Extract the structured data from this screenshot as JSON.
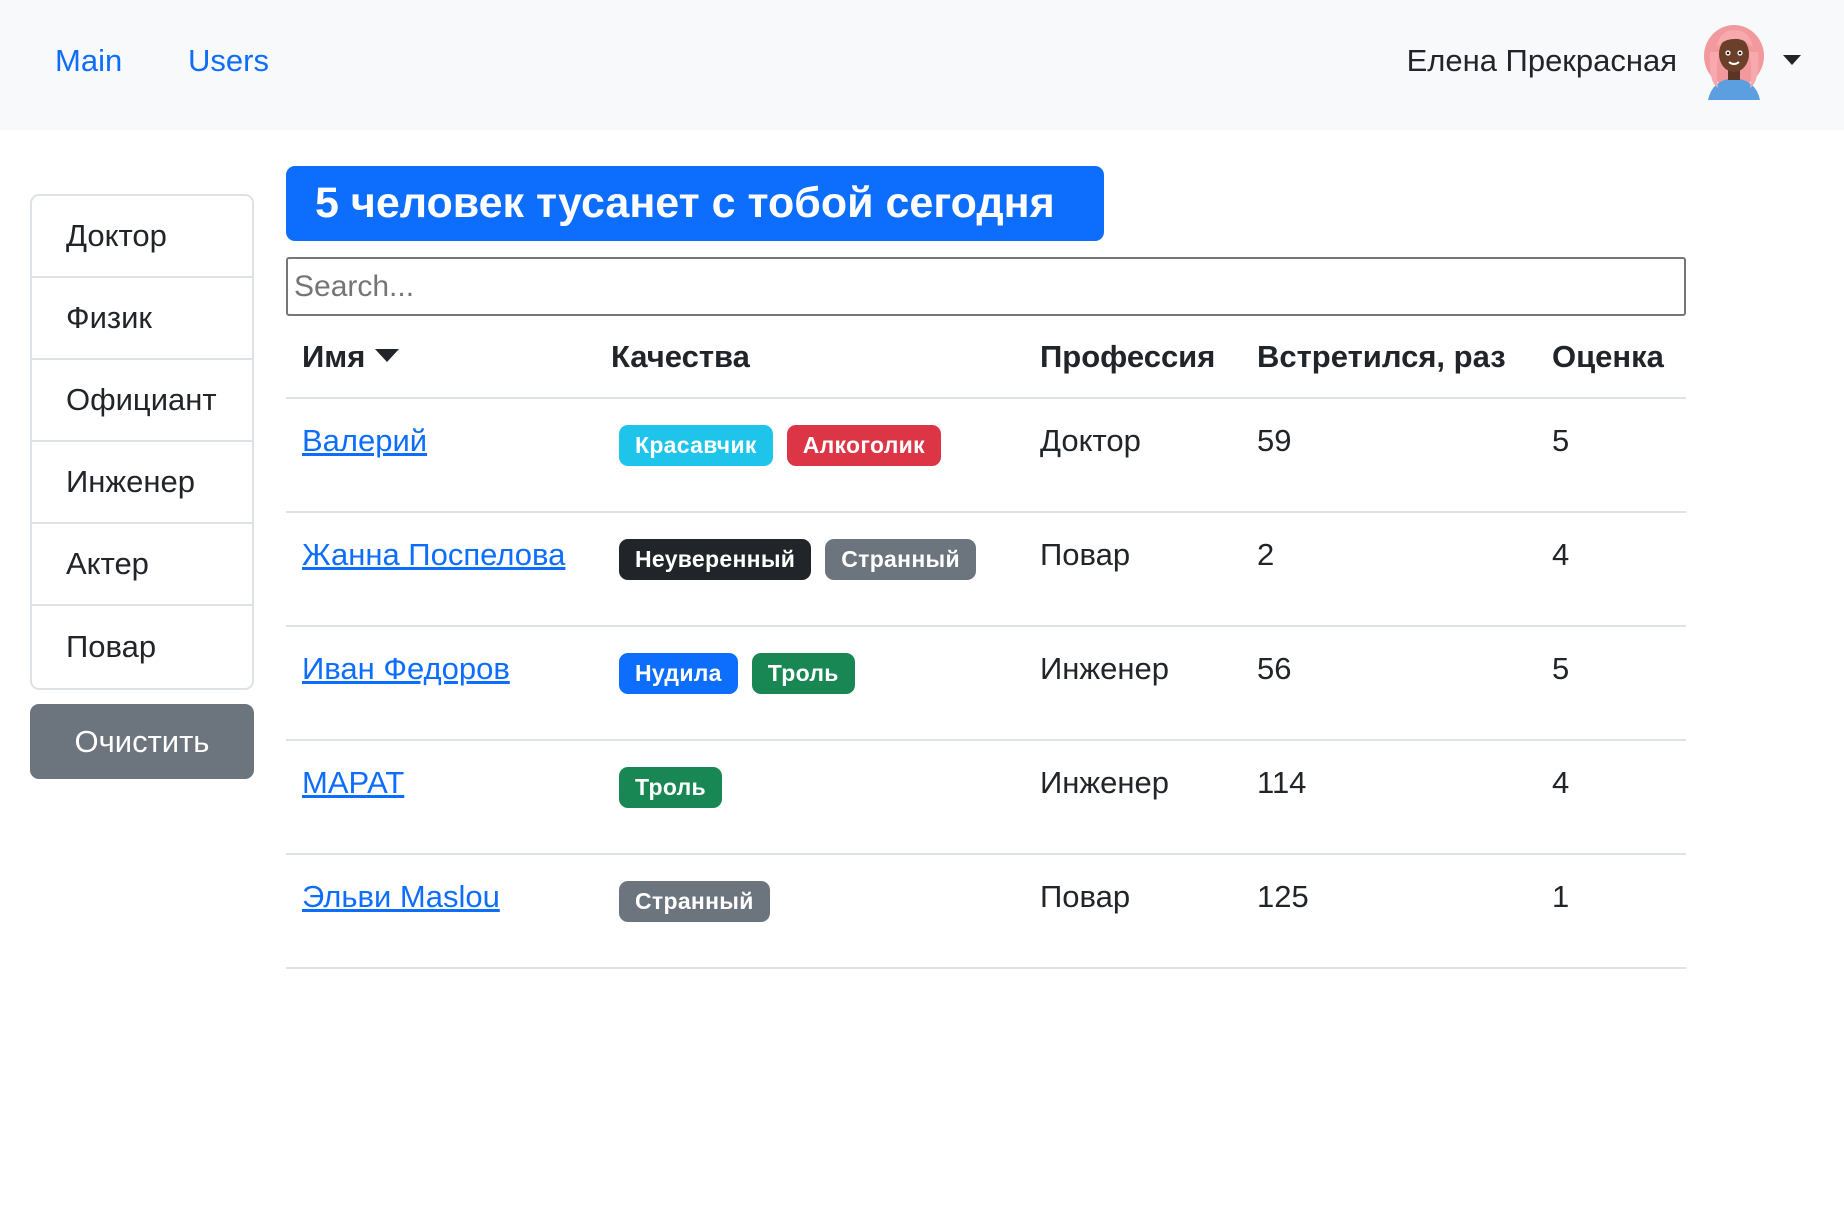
{
  "navbar": {
    "links": [
      {
        "label": "Main"
      },
      {
        "label": "Users"
      }
    ],
    "user_name": "Елена Прекрасная"
  },
  "sidebar": {
    "items": [
      {
        "label": "Доктор"
      },
      {
        "label": "Физик"
      },
      {
        "label": "Официант"
      },
      {
        "label": "Инженер"
      },
      {
        "label": "Актер"
      },
      {
        "label": "Повар"
      }
    ],
    "clear_label": "Очистить"
  },
  "banner": {
    "text": "5 человек тусанет с тобой сегодня"
  },
  "search": {
    "placeholder": "Search..."
  },
  "table": {
    "headers": {
      "name": "Имя",
      "qualities": "Качества",
      "profession": "Профессия",
      "met": "Встретился, раз",
      "rating": "Оценка"
    },
    "rows": [
      {
        "name": "Валерий",
        "qualities": [
          {
            "label": "Красавчик",
            "color": "#1ec4ea"
          },
          {
            "label": "Алкоголик",
            "color": "#dc3545"
          }
        ],
        "profession": "Доктор",
        "met": "59",
        "rating": "5"
      },
      {
        "name": "Жанна Поспелова",
        "qualities": [
          {
            "label": "Неуверенный",
            "color": "#212529"
          },
          {
            "label": "Странный",
            "color": "#6c757d"
          }
        ],
        "profession": "Повар",
        "met": "2",
        "rating": "4"
      },
      {
        "name": "Иван Федоров",
        "qualities": [
          {
            "label": "Нудила",
            "color": "#0d6efd"
          },
          {
            "label": "Троль",
            "color": "#198754"
          }
        ],
        "profession": "Инженер",
        "met": "56",
        "rating": "5"
      },
      {
        "name": "МАРАТ",
        "qualities": [
          {
            "label": "Троль",
            "color": "#198754"
          }
        ],
        "profession": "Инженер",
        "met": "114",
        "rating": "4"
      },
      {
        "name": "Эльви Maslou",
        "qualities": [
          {
            "label": "Странный",
            "color": "#6c757d"
          }
        ],
        "profession": "Повар",
        "met": "125",
        "rating": "1"
      }
    ]
  }
}
